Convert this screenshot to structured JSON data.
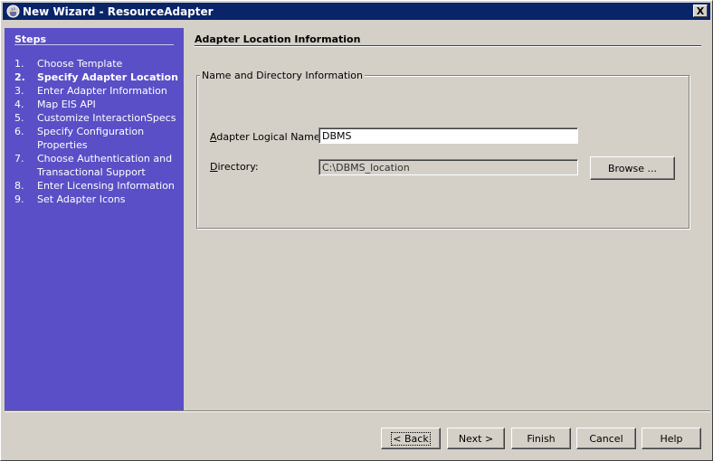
{
  "window": {
    "title": "New Wizard - ResourceAdapter",
    "close_label": "X"
  },
  "steps": {
    "header": "Steps",
    "items": [
      {
        "num": "1.",
        "label": "Choose Template",
        "active": false
      },
      {
        "num": "2.",
        "label": "Specify Adapter Location",
        "active": true
      },
      {
        "num": "3.",
        "label": "Enter Adapter Information",
        "active": false
      },
      {
        "num": "4.",
        "label": "Map EIS API",
        "active": false
      },
      {
        "num": "5.",
        "label": "Customize InteractionSpecs",
        "active": false
      },
      {
        "num": "6.",
        "label": "Specify Configuration Properties",
        "active": false
      },
      {
        "num": "7.",
        "label": "Choose Authentication and Transactional Support",
        "active": false
      },
      {
        "num": "8.",
        "label": "Enter Licensing Information",
        "active": false
      },
      {
        "num": "9.",
        "label": "Set Adapter Icons",
        "active": false
      }
    ]
  },
  "main": {
    "section_title": "Adapter Location Information",
    "group_title": "Name and Directory Information",
    "logical_name_label_mnemonic": "A",
    "logical_name_label_rest": "dapter Logical Name:",
    "logical_name_value": "DBMS",
    "directory_label_mnemonic": "D",
    "directory_label_rest": "irectory:",
    "directory_value": "C:\\DBMS_location",
    "browse_label": "Browse ..."
  },
  "buttons": {
    "back": "< Back",
    "next": "Next >",
    "finish": "Finish",
    "cancel": "Cancel",
    "help": "Help"
  }
}
